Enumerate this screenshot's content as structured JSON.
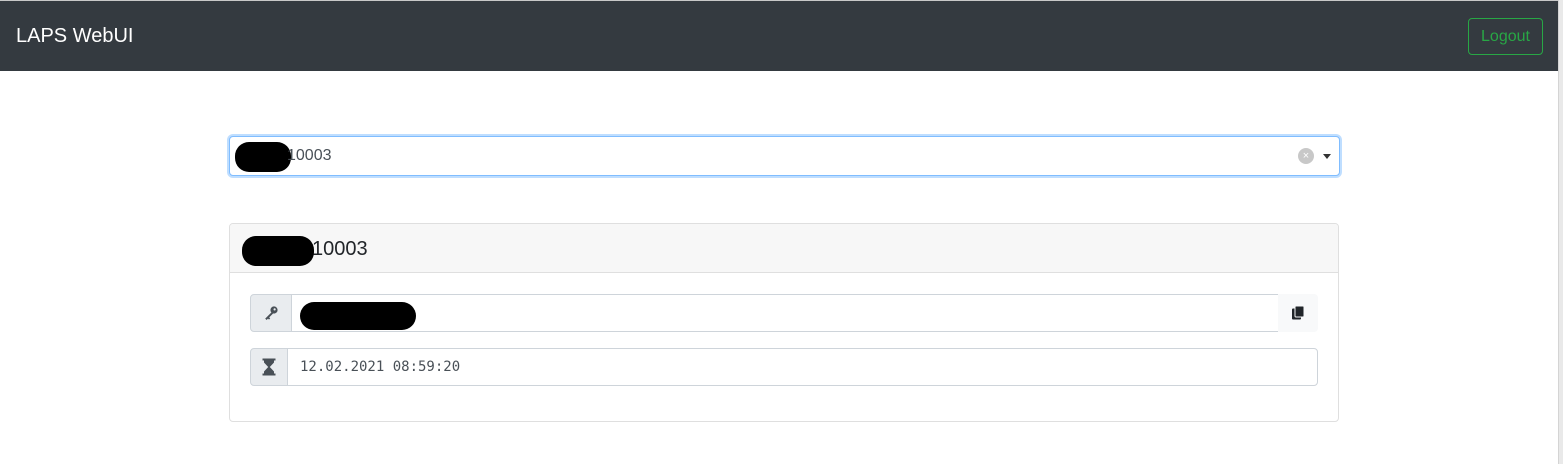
{
  "navbar": {
    "brand": "LAPS WebUI",
    "logout_label": "Logout"
  },
  "computer_select": {
    "visible_value": "10003",
    "clear_icon": "×"
  },
  "card": {
    "title_visible": "10003",
    "password_icon": "key-icon",
    "copy_icon": "copy-icon",
    "expiry_icon": "hourglass-icon",
    "expiry_value": "12.02.2021 08:59:20"
  },
  "colors": {
    "navbar_bg": "#343a40",
    "logout_accent": "#28a745",
    "select_focus": "#80bdff"
  }
}
